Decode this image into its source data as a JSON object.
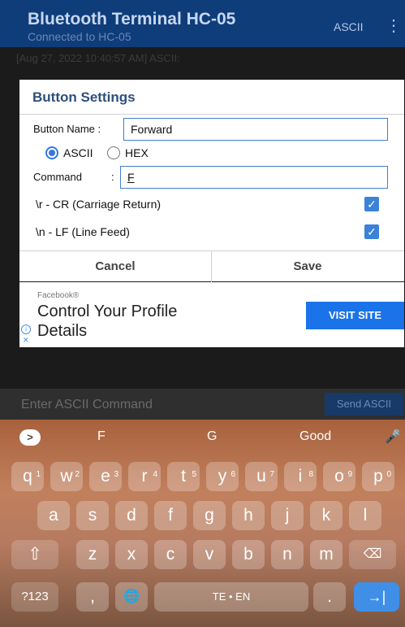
{
  "appbar": {
    "title": "Bluetooth Terminal HC-05",
    "subtitle": "Connected to HC-05",
    "mode": "ASCII",
    "menu_icon": "more-vert-icon"
  },
  "log": {
    "line": "[Aug 27, 2022 10:40:57 AM] ASCII:"
  },
  "dialog": {
    "title": "Button Settings",
    "name_label": "Button Name :",
    "name_value": "Forward",
    "radio_ascii": "ASCII",
    "radio_hex": "HEX",
    "command_label": "Command",
    "command_colon": ":",
    "command_value": "F",
    "cr_label": "\\r - CR (Carriage Return)",
    "lf_label": "\\n - LF (Line Feed)",
    "cancel": "Cancel",
    "save": "Save"
  },
  "ad": {
    "brand": "Facebook®",
    "headline1": "Control Your Profile",
    "headline2": "Details",
    "cta": "VISIT SITE"
  },
  "input": {
    "placeholder": "Enter ASCII Command",
    "send": "Send ASCII"
  },
  "keyboard": {
    "suggestions": [
      "F",
      "G",
      "Good"
    ],
    "row1": [
      "q",
      "w",
      "e",
      "r",
      "t",
      "y",
      "u",
      "i",
      "o",
      "p"
    ],
    "row1_nums": [
      "1",
      "2",
      "3",
      "4",
      "5",
      "6",
      "7",
      "8",
      "9",
      "0"
    ],
    "row2": [
      "a",
      "s",
      "d",
      "f",
      "g",
      "h",
      "j",
      "k",
      "l"
    ],
    "row3": [
      "z",
      "x",
      "c",
      "v",
      "b",
      "n",
      "m"
    ],
    "symbols": "?123",
    "comma": ",",
    "space": "TE • EN",
    "period": "."
  },
  "colors": {
    "appbar": "#0f3d7a",
    "accent": "#3578e5",
    "cta": "#1a73e8"
  }
}
